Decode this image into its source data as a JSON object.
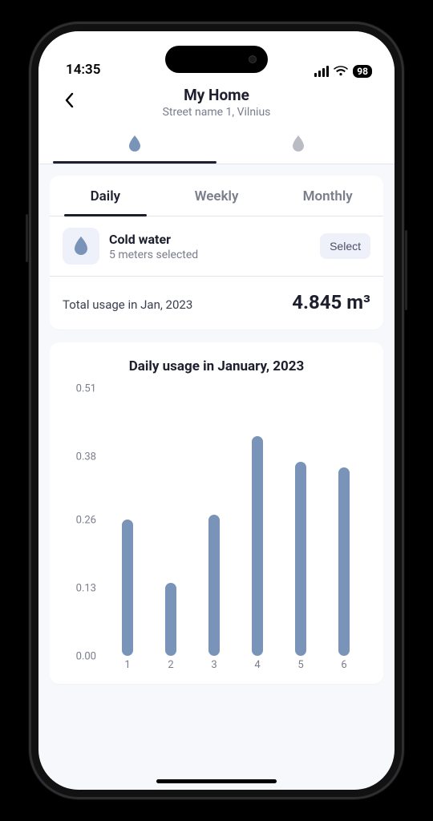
{
  "statusbar": {
    "time": "14:35",
    "battery": "98"
  },
  "header": {
    "title": "My Home",
    "subtitle": "Street name 1,  Vilnius"
  },
  "typetabs": {
    "items": [
      {
        "name": "cold-water-drop-icon",
        "color": "#7a93b8",
        "active": true
      },
      {
        "name": "hot-water-drop-icon",
        "color": "#b9bcc2",
        "active": false
      }
    ]
  },
  "period_tabs": {
    "items": [
      {
        "label": "Daily",
        "active": true
      },
      {
        "label": "Weekly",
        "active": false
      },
      {
        "label": "Monthly",
        "active": false
      }
    ]
  },
  "meter": {
    "title": "Cold water",
    "subtitle": "5 meters selected",
    "select_label": "Select",
    "icon_color": "#7a93b8"
  },
  "total": {
    "label": "Total usage in Jan, 2023",
    "value": "4.845 m³"
  },
  "chart_title": "Daily usage in January, 2023",
  "chart_data": {
    "type": "bar",
    "title": "Daily usage in January, 2023",
    "xlabel": "",
    "ylabel": "",
    "categories": [
      "1",
      "2",
      "3",
      "4",
      "5",
      "6"
    ],
    "values": [
      0.26,
      0.14,
      0.27,
      0.42,
      0.37,
      0.36
    ],
    "y_ticks": [
      "0.00",
      "0.13",
      "0.26",
      "0.38",
      "0.51"
    ],
    "ylim": [
      0,
      0.51
    ]
  },
  "colors": {
    "accent": "#7a93b8",
    "accent_light": "#eef0fa",
    "text_strong": "#1d1f2e",
    "text_muted": "#7a7d8c"
  }
}
